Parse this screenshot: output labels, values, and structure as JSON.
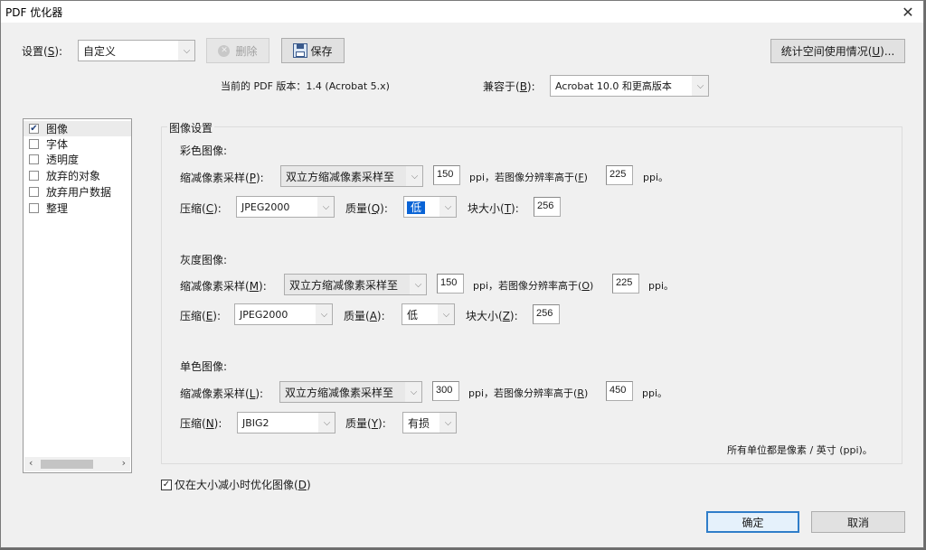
{
  "window": {
    "title": "PDF 优化器",
    "close_icon": "close-icon"
  },
  "settings": {
    "label": "设置(",
    "label_key": "S",
    "label_end": "):",
    "value": "自定义",
    "delete_label": "删除",
    "save_label": "保存",
    "stats_label": "统计空间使用情况(",
    "stats_key": "U",
    "stats_end": ")..."
  },
  "version": {
    "current_label": "当前的 PDF 版本：1.4 (Acrobat 5.x)",
    "compat_label": "兼容于(",
    "compat_key": "B",
    "compat_end": "):",
    "compat_value": "Acrobat 10.0 和更高版本"
  },
  "sidebar": {
    "items": [
      {
        "label": "图像",
        "checked": "✔",
        "selected": true
      },
      {
        "label": "字体",
        "checked": "",
        "selected": false
      },
      {
        "label": "透明度",
        "checked": "",
        "selected": false
      },
      {
        "label": "放弃的对象",
        "checked": "",
        "selected": false
      },
      {
        "label": "放弃用户数据",
        "checked": "",
        "selected": false
      },
      {
        "label": "整理",
        "checked": "",
        "selected": false
      }
    ],
    "scroll_left": "‹",
    "scroll_right": "›"
  },
  "image_settings": {
    "title": "图像设置",
    "color": {
      "heading": "彩色图像:",
      "downsample_label": "缩减像素采样(",
      "downsample_key": "P",
      "downsample_end": "):",
      "downsample_value": "双立方缩减像素采样至",
      "ppi_value": "150",
      "ppi_text": "ppi，若图像分辨率高于(",
      "ppi_key": "F",
      "ppi_end": ")",
      "above_value": "225",
      "ppi_unit": "ppi。",
      "compress_label": "压缩(",
      "compress_key": "C",
      "compress_end": "):",
      "compress_value": "JPEG2000",
      "quality_label": "质量(",
      "quality_key": "Q",
      "quality_end": "):",
      "quality_value": "低",
      "tile_label": "块大小(",
      "tile_key": "T",
      "tile_end": "):",
      "tile_value": "256"
    },
    "gray": {
      "heading": "灰度图像:",
      "downsample_label": "缩减像素采样(",
      "downsample_key": "M",
      "downsample_end": "):",
      "downsample_value": "双立方缩减像素采样至",
      "ppi_value": "150",
      "ppi_text": "ppi，若图像分辨率高于(",
      "ppi_key": "O",
      "ppi_end": ")",
      "above_value": "225",
      "ppi_unit": "ppi。",
      "compress_label": "压缩(",
      "compress_key": "E",
      "compress_end": "):",
      "compress_value": "JPEG2000",
      "quality_label": "质量(",
      "quality_key": "A",
      "quality_end": "):",
      "quality_value": "低",
      "tile_label": "块大小(",
      "tile_key": "Z",
      "tile_end": "):",
      "tile_value": "256"
    },
    "mono": {
      "heading": "单色图像:",
      "downsample_label": "缩减像素采样(",
      "downsample_key": "L",
      "downsample_end": "):",
      "downsample_value": "双立方缩减像素采样至",
      "ppi_value": "300",
      "ppi_text": "ppi，若图像分辨率高于(",
      "ppi_key": "R",
      "ppi_end": ")",
      "above_value": "450",
      "ppi_unit": "ppi。",
      "compress_label": "压缩(",
      "compress_key": "N",
      "compress_end": "):",
      "compress_value": "JBIG2",
      "quality_label": "质量(",
      "quality_key": "Y",
      "quality_end": "):",
      "quality_value": "有损"
    },
    "units_note": "所有单位都是像素 / 英寸 (ppi)。"
  },
  "optimize_only": {
    "label": "仅在大小减小时优化图像(",
    "key": "D",
    "end": ")",
    "checked": "✓"
  },
  "footer": {
    "ok_label": "确定",
    "cancel_label": "取消"
  }
}
